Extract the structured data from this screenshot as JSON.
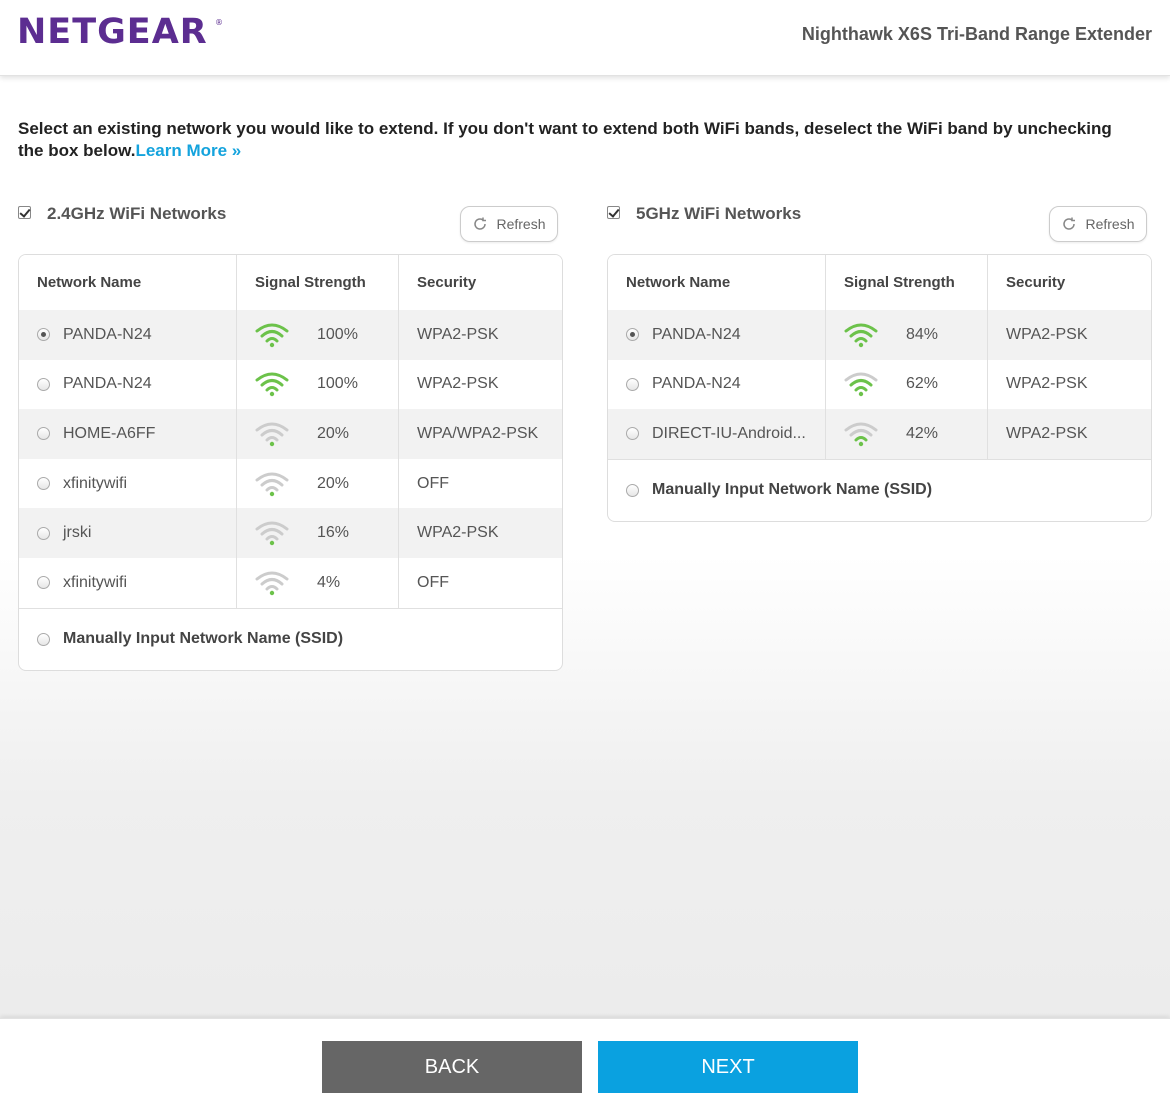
{
  "header": {
    "logo": "NETGEAR",
    "logo_mark": "®",
    "product": "Nighthawk X6S Tri-Band Range Extender"
  },
  "intro": {
    "text": "Select an existing network you would like to extend. If you don't want to extend both WiFi bands, deselect the WiFi band by unchecking the box below.",
    "link": "Learn More »"
  },
  "columns": {
    "network": "Network Name",
    "signal": "Signal Strength",
    "security": "Security"
  },
  "band24": {
    "title": "2.4GHz WiFi Networks",
    "checked": true,
    "refresh": "Refresh",
    "manual": "Manually Input Network Name (SSID)",
    "networks": [
      {
        "name": "PANDA-N24",
        "signal": "100%",
        "bars": 4,
        "security": "WPA2-PSK",
        "selected": true
      },
      {
        "name": "PANDA-N24",
        "signal": "100%",
        "bars": 4,
        "security": "WPA2-PSK",
        "selected": false
      },
      {
        "name": "HOME-A6FF",
        "signal": "20%",
        "bars": 1,
        "security": "WPA/WPA2-PSK",
        "selected": false
      },
      {
        "name": "xfinitywifi",
        "signal": "20%",
        "bars": 1,
        "security": "OFF",
        "selected": false
      },
      {
        "name": "jrski",
        "signal": "16%",
        "bars": 1,
        "security": "WPA2-PSK",
        "selected": false
      },
      {
        "name": "xfinitywifi",
        "signal": "4%",
        "bars": 1,
        "security": "OFF",
        "selected": false
      }
    ]
  },
  "band5": {
    "title": "5GHz WiFi Networks",
    "checked": true,
    "refresh": "Refresh",
    "manual": "Manually Input Network Name (SSID)",
    "networks": [
      {
        "name": "PANDA-N24",
        "signal": "84%",
        "bars": 4,
        "security": "WPA2-PSK",
        "selected": true
      },
      {
        "name": "PANDA-N24",
        "signal": "62%",
        "bars": 3,
        "security": "WPA2-PSK",
        "selected": false
      },
      {
        "name": "DIRECT-IU-Android...",
        "signal": "42%",
        "bars": 2,
        "security": "WPA2-PSK",
        "selected": false
      }
    ]
  },
  "footer": {
    "back": "BACK",
    "next": "NEXT"
  },
  "colors": {
    "brand": "#5c2d91",
    "link": "#14a3dd",
    "signal_on": "#6cc24a",
    "signal_off": "#cccccc",
    "back_button": "#666666",
    "next_button": "#0aa1e0"
  }
}
